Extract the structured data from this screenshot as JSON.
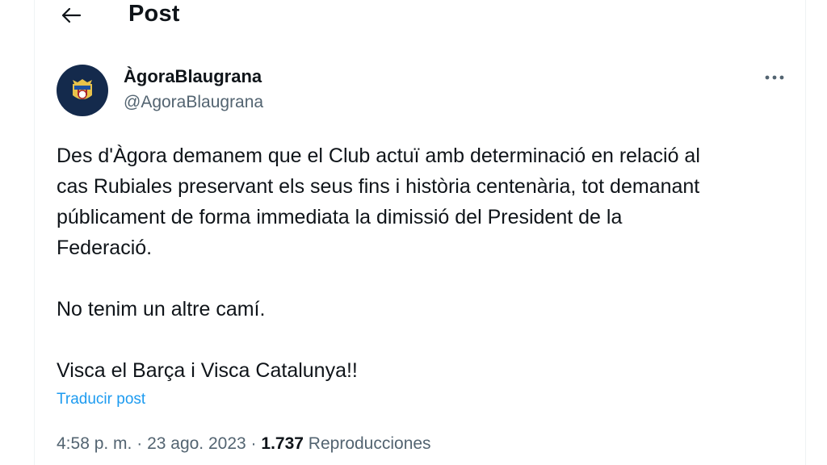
{
  "header": {
    "title": "Post",
    "back_icon": "arrow-left-icon"
  },
  "author": {
    "display_name": "ÀgoraBlaugrana",
    "handle": "@AgoraBlaugrana",
    "avatar_bg": "#142a4c"
  },
  "more_icon": "more-horizontal-icon",
  "tweet": {
    "lines": [
      "Des d'Àgora demanem que el Club actuï amb determinació en relació al",
      "cas Rubiales preservant els seus fins i història centenària, tot demanant",
      "públicament de forma immediata la dimissió del President de la",
      "Federació."
    ],
    "line2": "No tenim un altre camí.",
    "line3": "Visca el Barça i Visca Catalunya!!"
  },
  "translate_label": "Traducir post",
  "meta": {
    "time": "4:58 p. m.",
    "separator": "·",
    "date": "23 ago. 2023",
    "views_count": "1.737",
    "views_label": "Reproducciones"
  },
  "colors": {
    "link": "#1d9bf0",
    "secondary_text": "#536471",
    "primary_text": "#0f1419"
  }
}
